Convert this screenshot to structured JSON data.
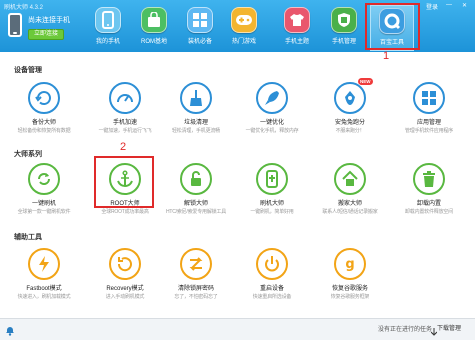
{
  "header": {
    "app_title": "刷机大师 4.3.2",
    "device_status": "尚未连接手机",
    "connect_label": "立即连接",
    "nav": [
      {
        "label": "我的手机",
        "icon": "phone-icon",
        "color": "#6dc6f0"
      },
      {
        "label": "ROM基地",
        "icon": "shopping-bag-icon",
        "color": "#4cbf63"
      },
      {
        "label": "装机必备",
        "icon": "apps-grid-icon",
        "color": "#5db8f2"
      },
      {
        "label": "热门游戏",
        "icon": "gamepad-icon",
        "color": "#f3b530"
      },
      {
        "label": "手机主题",
        "icon": "shirt-icon",
        "color": "#e9576d"
      },
      {
        "label": "手机管理",
        "icon": "shield-icon",
        "color": "#4ab04a"
      },
      {
        "label": "百宝工具",
        "icon": "tools-icon",
        "color": "#3c9de0"
      }
    ],
    "login": "登录",
    "minimize": "—",
    "close": "✕"
  },
  "annotations": {
    "one": "1",
    "two": "2"
  },
  "sections": [
    {
      "title": "设备管理",
      "tools": [
        {
          "name": "备份大师",
          "desc": "轻松备份和恢复所有数据",
          "icon": "backup-icon",
          "color": "#2c8fd6"
        },
        {
          "name": "手机加速",
          "desc": "一键加速，手机运行飞飞",
          "icon": "speedometer-icon",
          "color": "#2c8fd6"
        },
        {
          "name": "垃圾清理",
          "desc": "轻松清理，手机更流畅",
          "icon": "broom-icon",
          "color": "#2c8fd6"
        },
        {
          "name": "一键优化",
          "desc": "一键优化手机，释放内存",
          "icon": "rocket-icon",
          "color": "#2c8fd6"
        },
        {
          "name": "安兔兔跑分",
          "desc": "不服来跑分！",
          "icon": "antutu-icon",
          "color": "#2c8fd6",
          "badge": "NEW"
        },
        {
          "name": "应用管理",
          "desc": "管理手机软件应用程序",
          "icon": "app-manage-icon",
          "color": "#2c8fd6"
        }
      ]
    },
    {
      "title": "大师系列",
      "tools": [
        {
          "name": "一键刷机",
          "desc": "全球第一款一键刷机软件",
          "icon": "refresh-icon",
          "color": "#59b840"
        },
        {
          "name": "ROOT大师",
          "desc": "全球ROOT成功率最高",
          "icon": "anchor-icon",
          "color": "#59b840"
        },
        {
          "name": "解锁大师",
          "desc": "HTC/索尼/索爱专用解锁工具",
          "icon": "unlock-icon",
          "color": "#59b840"
        },
        {
          "name": "刷机大师",
          "desc": "一键刷机，简单好用",
          "icon": "phone-flash-icon",
          "color": "#59b840"
        },
        {
          "name": "搬家大师",
          "desc": "联系人/短信/通话记录搬家",
          "icon": "house-icon",
          "color": "#59b840"
        },
        {
          "name": "卸载内置",
          "desc": "卸载内置软件释放空间",
          "icon": "trash-icon",
          "color": "#59b840"
        }
      ]
    },
    {
      "title": "辅助工具",
      "tools": [
        {
          "name": "Fastboot模式",
          "desc": "快速进入，刷机加载模式",
          "icon": "lightning-icon",
          "color": "#f2a416"
        },
        {
          "name": "Recovery模式",
          "desc": "进入手动刷机模式",
          "icon": "recovery-icon",
          "color": "#f2a416"
        },
        {
          "name": "清除锁屏密码",
          "desc": "忘了，不怕密码忘了",
          "icon": "swap-icon",
          "color": "#f2a416"
        },
        {
          "name": "重启设备",
          "desc": "快速重启所选设备",
          "icon": "power-icon",
          "color": "#f2a416"
        },
        {
          "name": "恢复谷歌服务",
          "desc": "恢复谷歌服务框架",
          "icon": "google-icon",
          "color": "#f2a416"
        }
      ]
    }
  ],
  "footer": {
    "task_status": "没有正在进行的任务",
    "download_manager": "下载管理"
  }
}
